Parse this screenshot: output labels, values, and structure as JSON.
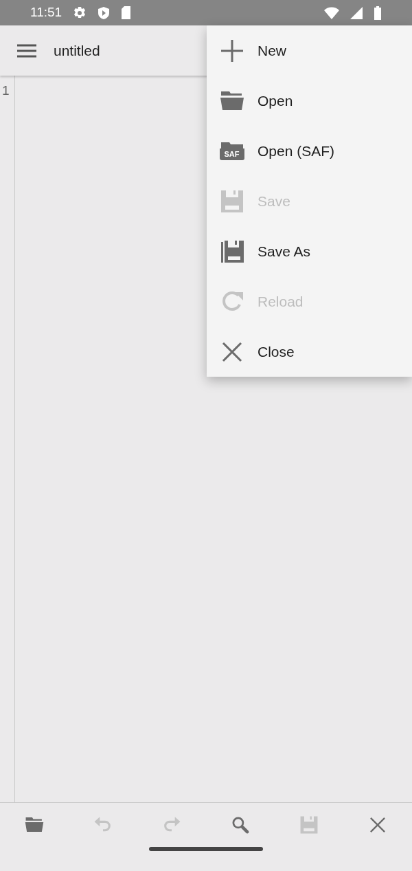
{
  "status_bar": {
    "time": "11:51"
  },
  "app_bar": {
    "title": "untitled"
  },
  "editor": {
    "line_numbers": [
      "1"
    ]
  },
  "menu": {
    "items": [
      {
        "kind": "new",
        "label": "New",
        "disabled": false
      },
      {
        "kind": "open",
        "label": "Open",
        "disabled": false
      },
      {
        "kind": "saf",
        "label": "Open (SAF)",
        "icon_text": "SAF",
        "disabled": false
      },
      {
        "kind": "save",
        "label": "Save",
        "disabled": true
      },
      {
        "kind": "saveas",
        "label": "Save As",
        "disabled": false
      },
      {
        "kind": "reload",
        "label": "Reload",
        "disabled": true
      },
      {
        "kind": "close",
        "label": "Close",
        "disabled": false
      }
    ]
  },
  "bottom_toolbar": {
    "buttons": [
      {
        "kind": "open",
        "disabled": false
      },
      {
        "kind": "undo",
        "disabled": true
      },
      {
        "kind": "redo",
        "disabled": true
      },
      {
        "kind": "search",
        "disabled": false
      },
      {
        "kind": "save",
        "disabled": true
      },
      {
        "kind": "close",
        "disabled": false
      }
    ]
  }
}
